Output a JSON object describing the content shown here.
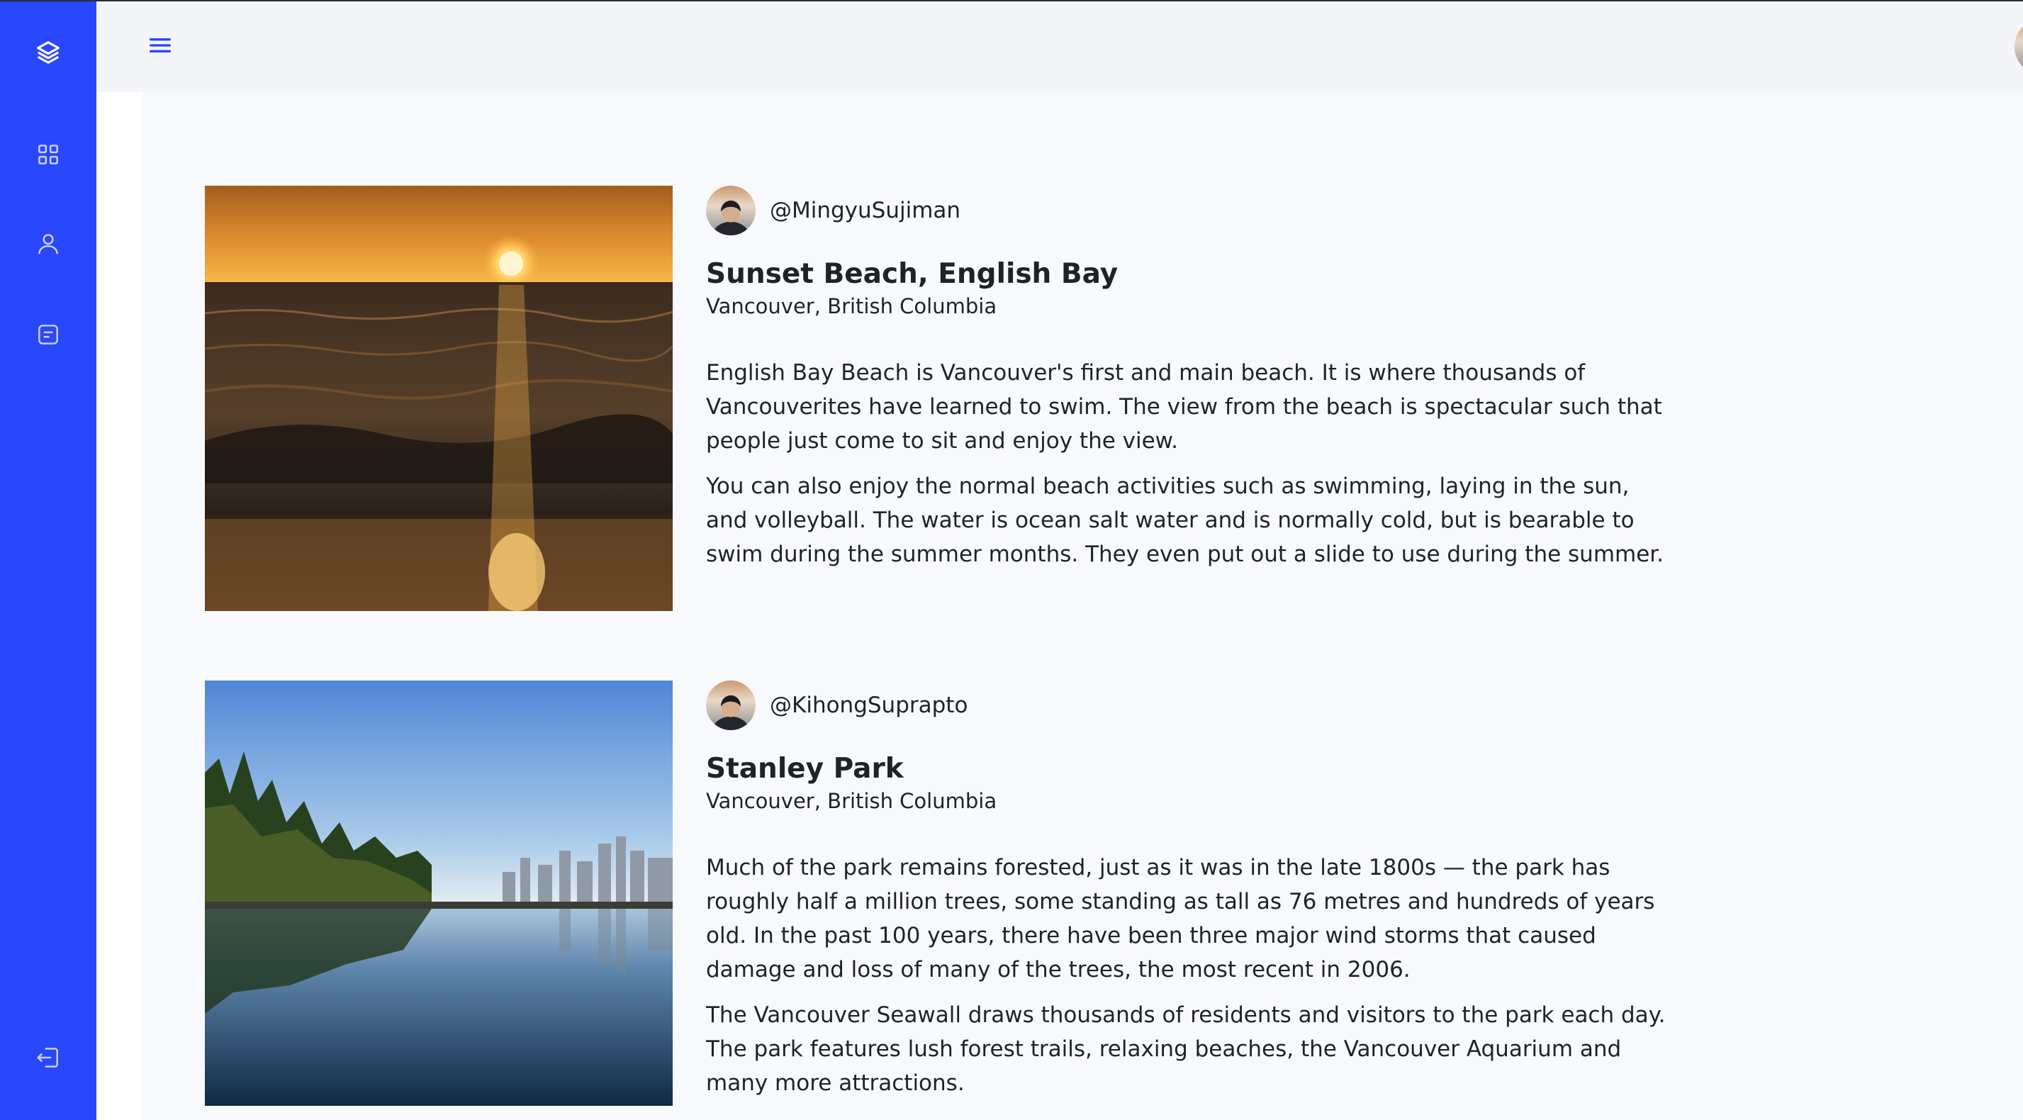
{
  "sidebar": {
    "icons": [
      "layers-icon",
      "grid-icon",
      "user-icon",
      "message-icon",
      "logout-icon"
    ],
    "accent": "#2947fb"
  },
  "header": {
    "menu_icon": "hamburger-menu-icon",
    "avatar": "profile-avatar"
  },
  "posts": [
    {
      "username": "@MingyuSujiman",
      "title": "Sunset Beach, English Bay",
      "location": "Vancouver, British Columbia",
      "paragraphs": [
        "English Bay Beach is Vancouver's first and main beach. It is where thousands of Vancouverites have learned to swim. The view from the beach is spectacular such that people just come to sit and enjoy the view.",
        "You can also enjoy the normal beach activities such as swimming, laying in the sun, and volleyball. The water is ocean salt water and is normally cold, but is bearable to swim during the summer months. They even put out a slide to use during the summer."
      ]
    },
    {
      "username": "@KihongSuprapto",
      "title": "Stanley Park",
      "location": "Vancouver, British Columbia",
      "paragraphs": [
        "Much of the park remains forested, just as it was in the late 1800s — the park has roughly half a million trees, some standing as tall as 76 metres and hundreds of years old. In the past 100 years, there have been three major wind storms that caused damage and loss of many of the trees, the most recent in 2006.",
        "The Vancouver Seawall draws thousands of residents and visitors to the park each day. The park features lush forest trails, relaxing beaches, the Vancouver Aquarium and many more attractions."
      ]
    }
  ]
}
